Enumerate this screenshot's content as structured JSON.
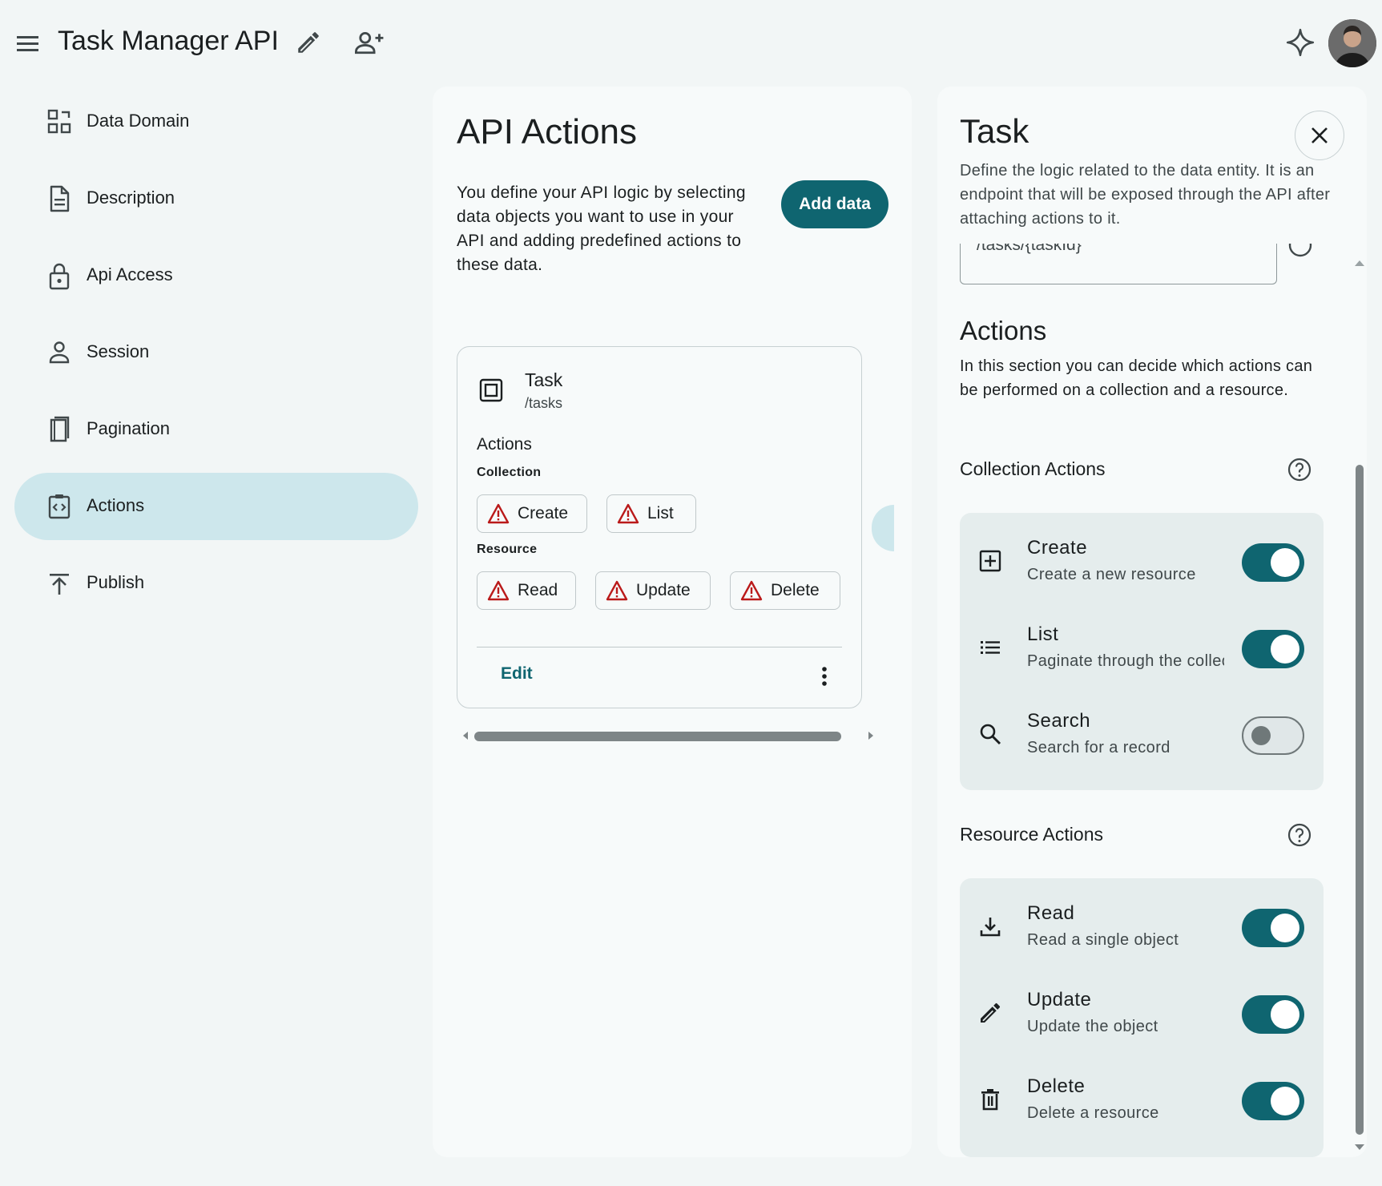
{
  "header": {
    "app_title": "Task Manager API",
    "icons": [
      "menu-icon",
      "pencil-icon",
      "person-add-icon",
      "sparkle-icon"
    ]
  },
  "sidebar": {
    "items": [
      {
        "label": "Data Domain",
        "icon": "data-domain-icon"
      },
      {
        "label": "Description",
        "icon": "document-icon"
      },
      {
        "label": "Api Access",
        "icon": "lock-icon"
      },
      {
        "label": "Session",
        "icon": "person-icon"
      },
      {
        "label": "Pagination",
        "icon": "book-icon"
      },
      {
        "label": "Actions",
        "icon": "code-clipboard-icon",
        "active": true
      },
      {
        "label": "Publish",
        "icon": "publish-icon"
      }
    ]
  },
  "main": {
    "title": "API Actions",
    "description": "You define your API logic by selecting data objects you want to use in your API and adding predefined actions to these data.",
    "add_button": "Add data",
    "card": {
      "title": "Task",
      "path": "/tasks",
      "actions_label": "Actions",
      "collection_label": "Collection",
      "collection_chips": [
        "Create",
        "List"
      ],
      "resource_label": "Resource",
      "resource_chips": [
        "Read",
        "Update",
        "Delete"
      ],
      "edit_label": "Edit"
    }
  },
  "panel": {
    "title": "Task",
    "description": "Define the logic related to the data entity. It is an endpoint that will be exposed through the API after attaching actions to it.",
    "path_value": "/tasks/{taskId}",
    "actions_title": "Actions",
    "actions_description": "In this section you can decide which actions can be performed on a collection and a resource.",
    "collection_actions": {
      "heading": "Collection Actions",
      "rows": [
        {
          "title": "Create",
          "subtitle": "Create a new resource",
          "enabled": true,
          "icon": "add-box-icon"
        },
        {
          "title": "List",
          "subtitle": "Paginate through the collection",
          "enabled": true,
          "icon": "list-icon"
        },
        {
          "title": "Search",
          "subtitle": "Search for a record",
          "enabled": false,
          "icon": "search-icon"
        }
      ]
    },
    "resource_actions": {
      "heading": "Resource Actions",
      "rows": [
        {
          "title": "Read",
          "subtitle": "Read a single object",
          "enabled": true,
          "icon": "download-icon"
        },
        {
          "title": "Update",
          "subtitle": "Update the object",
          "enabled": true,
          "icon": "pencil-icon"
        },
        {
          "title": "Delete",
          "subtitle": "Delete a resource",
          "enabled": true,
          "icon": "trash-icon"
        }
      ]
    }
  },
  "colors": {
    "accent": "#0f6570",
    "active_nav": "#cde7ec",
    "warning": "#ba1a1a",
    "background": "#f2f6f6"
  }
}
